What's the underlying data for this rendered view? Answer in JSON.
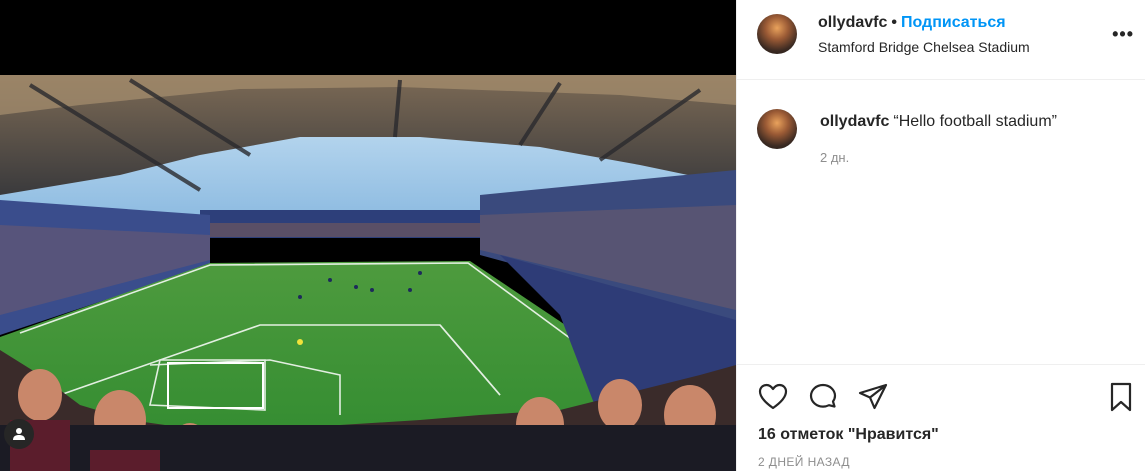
{
  "post": {
    "username": "ollydavfc",
    "separator": "•",
    "follow_label": "Подписаться",
    "location": "Stamford Bridge Chelsea Stadium",
    "more_label": "•••"
  },
  "caption": {
    "username": "ollydavfc",
    "text": "“Hello football stadium”",
    "time": "2 дн."
  },
  "actions": {
    "likes": "16 отметок \"Нравится\"",
    "posted": "2 ДНЕЙ НАЗАД"
  },
  "icons": {
    "like": "heart-icon",
    "comment": "comment-icon",
    "share": "paper-plane-icon",
    "save": "bookmark-icon",
    "tags": "user-tag-icon"
  },
  "colors": {
    "link": "#0095f6",
    "muted": "#8e8e8e",
    "text": "#262626",
    "pitch": "#3f9d3a"
  }
}
